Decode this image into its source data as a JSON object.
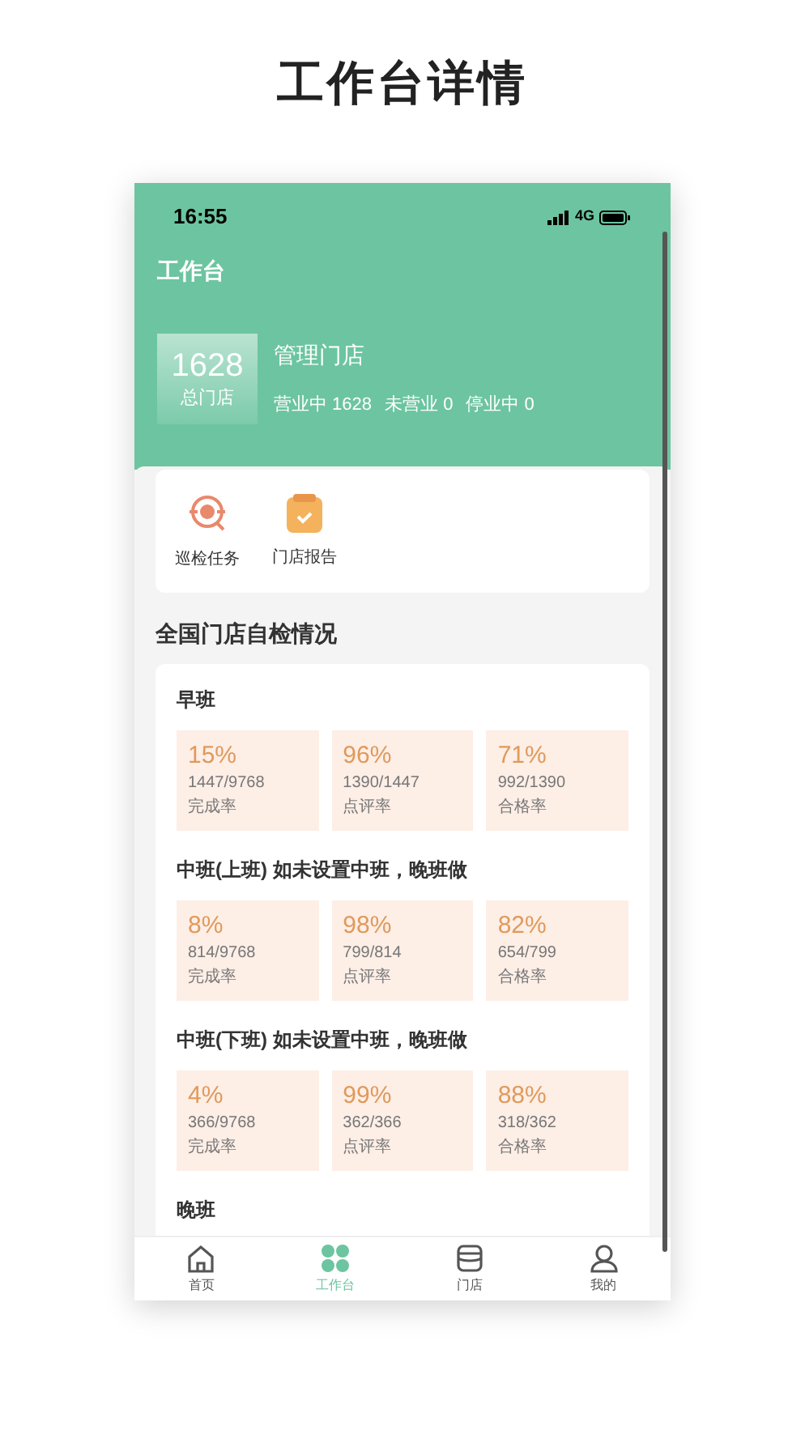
{
  "page_title": "工作台详情",
  "status_bar": {
    "time": "16:55",
    "network": "4G"
  },
  "header": {
    "title": "工作台",
    "total": {
      "value": "1628",
      "label": "总门店"
    },
    "manage_title": "管理门店",
    "stats": [
      "营业中 1628",
      "未营业 0",
      "停业中 0"
    ]
  },
  "shortcuts": [
    {
      "label": "巡检任务",
      "kind": "patrol"
    },
    {
      "label": "门店报告",
      "kind": "report"
    }
  ],
  "section_title": "全国门店自检情况",
  "shifts": [
    {
      "name": "早班",
      "metrics": [
        {
          "percent": "15%",
          "ratio": "1447/9768",
          "label": "完成率"
        },
        {
          "percent": "96%",
          "ratio": "1390/1447",
          "label": "点评率"
        },
        {
          "percent": "71%",
          "ratio": "992/1390",
          "label": "合格率"
        }
      ]
    },
    {
      "name": "中班(上班) 如未设置中班，晚班做",
      "metrics": [
        {
          "percent": "8%",
          "ratio": "814/9768",
          "label": "完成率"
        },
        {
          "percent": "98%",
          "ratio": "799/814",
          "label": "点评率"
        },
        {
          "percent": "82%",
          "ratio": "654/799",
          "label": "合格率"
        }
      ]
    },
    {
      "name": "中班(下班) 如未设置中班，晚班做",
      "metrics": [
        {
          "percent": "4%",
          "ratio": "366/9768",
          "label": "完成率"
        },
        {
          "percent": "99%",
          "ratio": "362/366",
          "label": "点评率"
        },
        {
          "percent": "88%",
          "ratio": "318/362",
          "label": "合格率"
        }
      ]
    },
    {
      "name": "晚班"
    }
  ],
  "tabs": [
    {
      "label": "首页",
      "kind": "home",
      "selected": false
    },
    {
      "label": "工作台",
      "kind": "workbench",
      "selected": true
    },
    {
      "label": "门店",
      "kind": "store",
      "selected": false
    },
    {
      "label": "我的",
      "kind": "profile",
      "selected": false
    }
  ]
}
